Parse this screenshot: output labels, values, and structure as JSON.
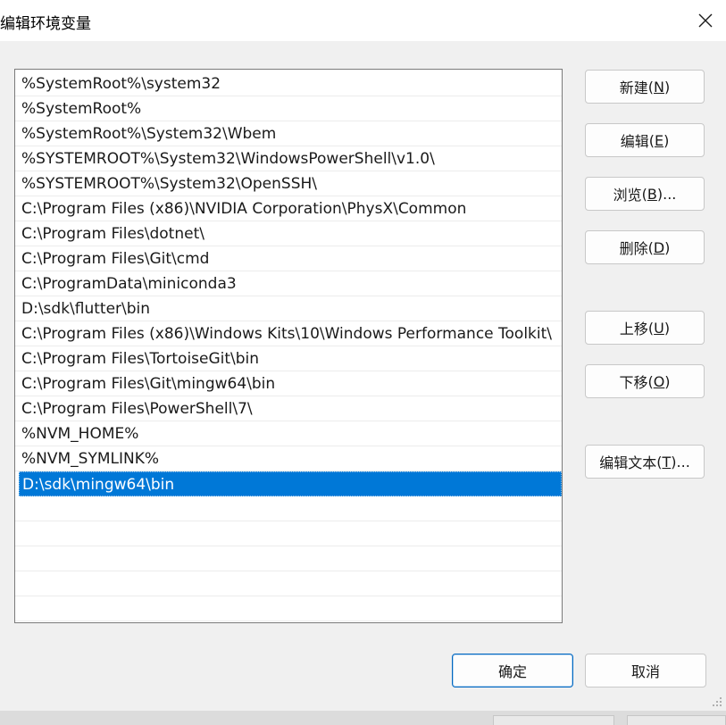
{
  "window": {
    "title": "编辑环境变量"
  },
  "list": {
    "items": [
      "%SystemRoot%\\system32",
      "%SystemRoot%",
      "%SystemRoot%\\System32\\Wbem",
      "%SYSTEMROOT%\\System32\\WindowsPowerShell\\v1.0\\",
      "%SYSTEMROOT%\\System32\\OpenSSH\\",
      "C:\\Program Files (x86)\\NVIDIA Corporation\\PhysX\\Common",
      "C:\\Program Files\\dotnet\\",
      "C:\\Program Files\\Git\\cmd",
      "C:\\ProgramData\\miniconda3",
      "D:\\sdk\\flutter\\bin",
      "C:\\Program Files (x86)\\Windows Kits\\10\\Windows Performance Toolkit\\",
      "C:\\Program Files\\TortoiseGit\\bin",
      "C:\\Program Files\\Git\\mingw64\\bin",
      "C:\\Program Files\\PowerShell\\7\\",
      "%NVM_HOME%",
      "%NVM_SYMLINK%",
      "D:\\sdk\\mingw64\\bin"
    ],
    "selected_index": 16
  },
  "buttons": {
    "new": {
      "label": "新建",
      "key": "N"
    },
    "edit": {
      "label": "编辑",
      "key": "E"
    },
    "browse": {
      "label": "浏览",
      "key": "B",
      "suffix": "..."
    },
    "delete": {
      "label": "删除",
      "key": "D"
    },
    "move_up": {
      "label": "上移",
      "key": "U"
    },
    "move_down": {
      "label": "下移",
      "key": "O"
    },
    "edit_text": {
      "label": "编辑文本",
      "key": "T",
      "suffix": "..."
    },
    "ok": {
      "label": "确定"
    },
    "cancel": {
      "label": "取消"
    }
  },
  "colors": {
    "selection": "#0078d7",
    "default_button_border": "#0067c0",
    "dialog_bg": "#f0f0f0"
  }
}
